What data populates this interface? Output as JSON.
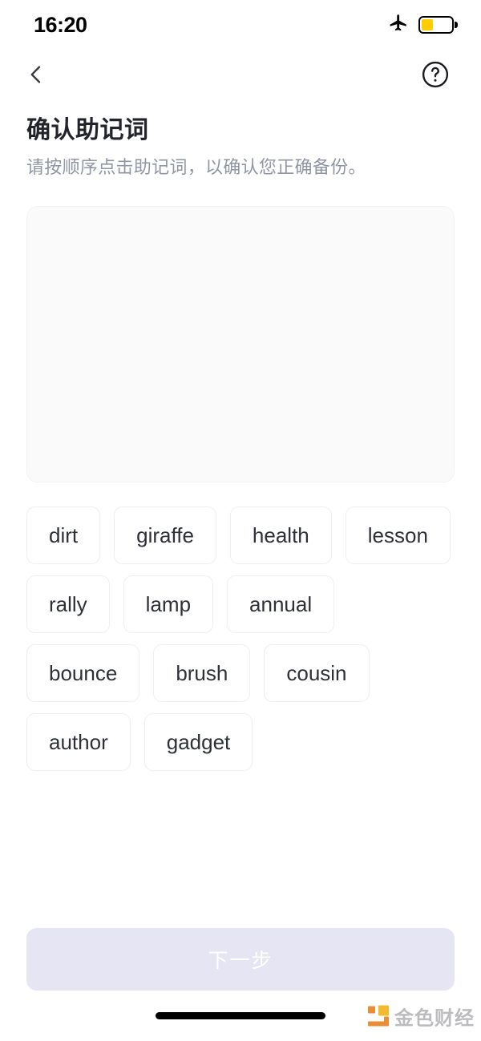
{
  "status_bar": {
    "time": "16:20",
    "airplane_icon": "airplane-mode-icon",
    "battery_icon": "battery-icon",
    "battery_level_percent": 40,
    "battery_color": "#FFCC00"
  },
  "nav_bar": {
    "back_icon": "chevron-left-icon",
    "help_icon": "question-mark-circle-icon"
  },
  "header": {
    "title": "确认助记词",
    "subtitle": "请按顺序点击助记词，以确认您正确备份。"
  },
  "drop_area": {
    "selected_words": [],
    "placeholder": ""
  },
  "word_bank": {
    "words": [
      "dirt",
      "giraffe",
      "health",
      "lesson",
      "rally",
      "lamp",
      "annual",
      "bounce",
      "brush",
      "cousin",
      "author",
      "gadget"
    ]
  },
  "footer": {
    "next_button_label": "下一步",
    "next_button_enabled": false,
    "next_button_color": "#E5E5F3",
    "next_button_text_color": "#FFFFFF"
  },
  "watermark": {
    "text": "金色财经",
    "logo_icon": "jinse-logo-icon",
    "logo_colors": [
      "#E8892B",
      "#F4B722"
    ]
  },
  "home_indicator": {
    "label": "home-indicator"
  }
}
